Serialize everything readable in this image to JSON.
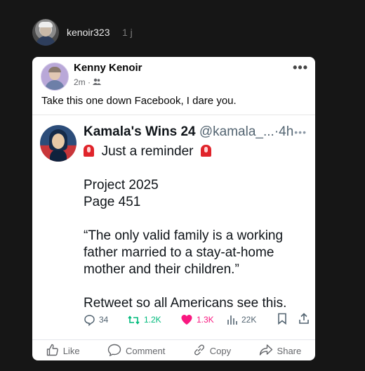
{
  "header": {
    "username": "kenoir323",
    "time": "1 j"
  },
  "fb_post": {
    "author": "Kenny Kenoir",
    "time": "2m ·",
    "audience_icon": "friends-icon",
    "text": "Take this one down Facebook, I dare you."
  },
  "tweet": {
    "name": "Kamala's Wins 24",
    "handle": "@kamala_...",
    "time": "·4h",
    "line1": "Just a reminder",
    "line2": "Project 2025",
    "line3": "Page 451",
    "quote_1": "“The only valid family is a working",
    "quote_2": "father married to a stay-at-home",
    "quote_3": "mother and their children.”",
    "cta": "Retweet so all Americans see this.",
    "stats": {
      "replies": "34",
      "retweets": "1.2K",
      "likes": "1.3K",
      "views": "22K"
    }
  },
  "fb_actions": {
    "like": "Like",
    "comment": "Comment",
    "copy": "Copy",
    "share": "Share"
  },
  "colors": {
    "page_bg": "#161616",
    "retweet": "#00ba7c",
    "like": "#f91880"
  }
}
